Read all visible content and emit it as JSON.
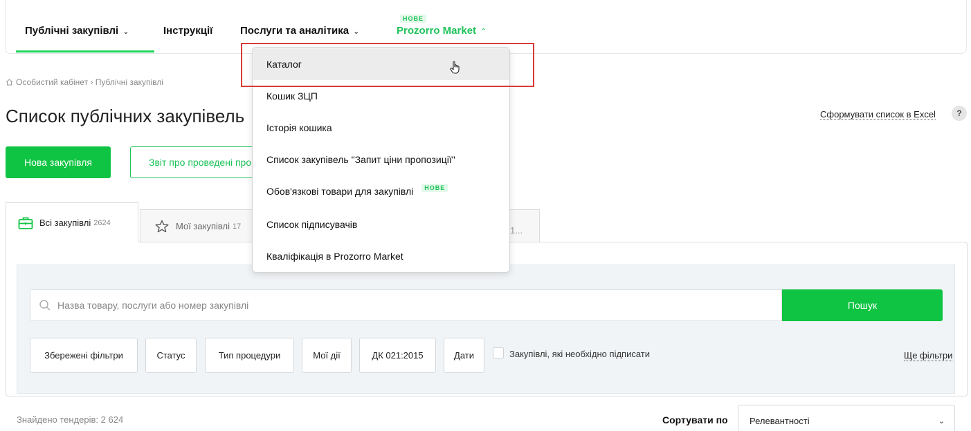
{
  "nav": {
    "items": [
      {
        "label": "Публічні закупівлі",
        "chevron": "chevron-down"
      },
      {
        "label": "Інструкції"
      },
      {
        "label": "Послуги та аналітика",
        "chevron": "chevron-down"
      },
      {
        "label": "Prozorro Market",
        "chevron": "chevron-up",
        "badge": "НОВЕ"
      }
    ]
  },
  "breadcrumb": {
    "home": "Особистий кабінет",
    "separator": "›",
    "current": "Публічні закупівлі"
  },
  "page": {
    "title": "Список публічних закупівель"
  },
  "actions": {
    "excel": "Сформувати список в Excel",
    "help": "?",
    "new_tender": "Нова закупівля",
    "report": "Звіт про проведені процедури"
  },
  "tabs": [
    {
      "label": "Всі закупівлі",
      "count": "2624",
      "icon": "briefcase-icon"
    },
    {
      "label": "Мої закупівлі",
      "count": "17",
      "icon": "star-icon"
    }
  ],
  "tabs_more": "1...",
  "search": {
    "placeholder": "Назва товару, послуги або номер закупівлі",
    "button": "Пошук"
  },
  "filters": [
    "Збережені фільтри",
    "Статус",
    "Тип процедури",
    "Мої дії",
    "ДК 021:2015",
    "Дати"
  ],
  "checkbox_label": "Закупівлі, які необхідно підписати",
  "more_filters": "Ще фільтри",
  "results": {
    "found": "Знайдено тендерів: 2 624",
    "sort_label": "Сортувати по",
    "sort_value": "Релевантності"
  },
  "dropdown": {
    "items": [
      {
        "label": "Каталог"
      },
      {
        "label": "Кошик ЗЦП"
      },
      {
        "label": "Історія кошика"
      },
      {
        "label": "Список закупівель \"Запит ціни пропозиції\""
      },
      {
        "label": "Обов'язкові товари для закупівлі",
        "badge": "НОВЕ"
      },
      {
        "label": "Список підписувачів"
      },
      {
        "label": "Кваліфікація в Prozorro Market"
      }
    ]
  },
  "colors": {
    "accent": "#10c443",
    "market": "#1ec25a",
    "highlight": "#d93a3a"
  }
}
